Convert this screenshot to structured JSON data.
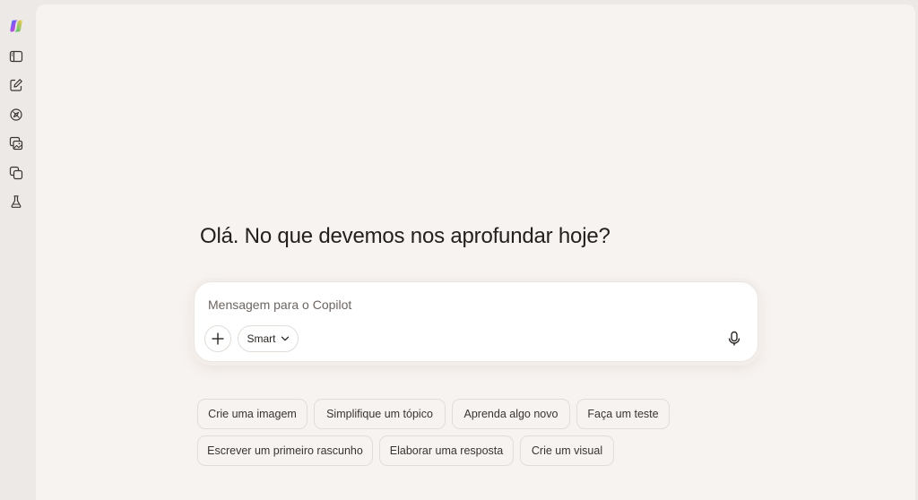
{
  "sidebar": {
    "items": [
      {
        "icon": "copilot-logo-icon"
      },
      {
        "icon": "sidebar-toggle-icon"
      },
      {
        "icon": "new-chat-icon"
      },
      {
        "icon": "discover-icon"
      },
      {
        "icon": "image-gallery-icon"
      },
      {
        "icon": "pages-icon"
      },
      {
        "icon": "labs-flask-icon"
      }
    ]
  },
  "main": {
    "greeting": "Olá. No que devemos nos aprofundar hoje?",
    "composer": {
      "placeholder": "Mensagem para o Copilot",
      "mode_label": "Smart"
    },
    "suggestions": [
      "Crie uma imagem",
      "Simplifique um tópico",
      "Aprenda algo novo",
      "Faça um teste",
      "Escrever um primeiro rascunho",
      "Elaborar uma resposta",
      "Crie um visual"
    ]
  },
  "colors": {
    "page_background": "#f7f3f0",
    "rail_background": "#ede9e6",
    "text": "#24201e"
  }
}
